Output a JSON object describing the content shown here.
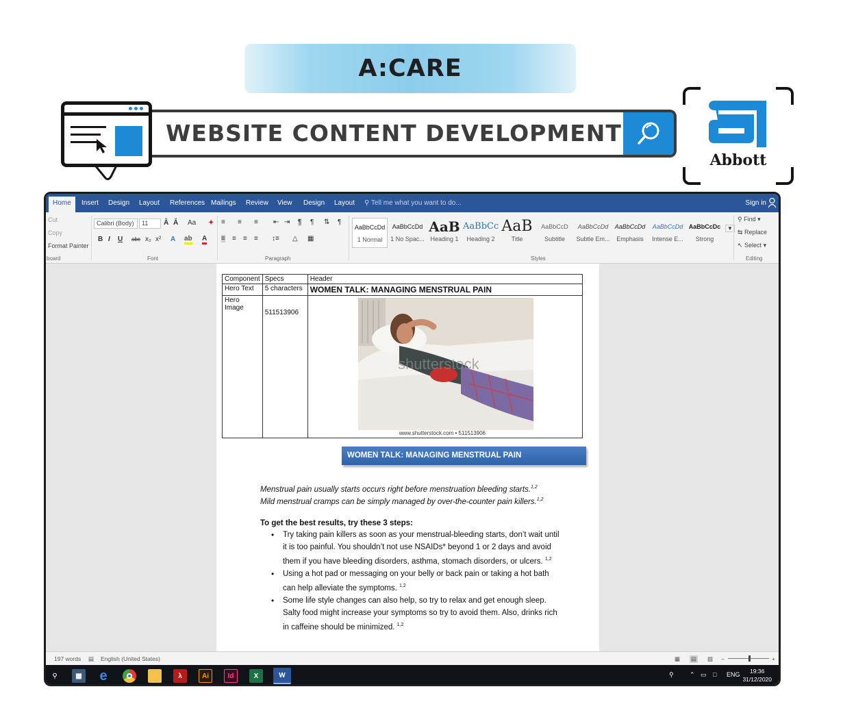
{
  "banner": {
    "title": "A:CARE",
    "search_label": "WEBSITE CONTENT DEVELOPMENT",
    "brand": "Abbott"
  },
  "colors": {
    "accent_blue": "#1c8ad6",
    "word_blue": "#2b579a",
    "heading_blue": "#2d62ab",
    "pill_blue": "#8ccdec"
  },
  "icons": [
    "browser-window-icon",
    "cursor-arrow-icon",
    "search-icon",
    "abbott-logo-icon",
    "person-icon"
  ],
  "word": {
    "tabs": [
      "Home",
      "Insert",
      "Design",
      "Layout",
      "References",
      "Mailings",
      "Review",
      "View",
      "Design",
      "Layout"
    ],
    "active_tab": "Home",
    "tell_me": "Tell me what you want to do...",
    "sign_in": "Sign in",
    "clipboard": {
      "cut": "Cut",
      "copy": "Copy",
      "format_painter": "Format Painter",
      "label": "board"
    },
    "font": {
      "family": "Calibri (Body)",
      "size": "11",
      "label": "Font"
    },
    "paragraph_label": "Paragraph",
    "styles": [
      {
        "preview": "AaBbCcDd",
        "name": "1 Normal"
      },
      {
        "preview": "AaBbCcDd",
        "name": "1 No Spac..."
      },
      {
        "preview": "AaB",
        "name": "Heading 1"
      },
      {
        "preview": "AaBbCc",
        "name": "Heading 2"
      },
      {
        "preview": "AaB",
        "name": "Title"
      },
      {
        "preview": "AaBbCcD",
        "name": "Subtitle"
      },
      {
        "preview": "AaBbCcDd",
        "name": "Subtle Em..."
      },
      {
        "preview": "AaBbCcDd",
        "name": "Emphasis"
      },
      {
        "preview": "AaBbCcDd",
        "name": "Intense E..."
      },
      {
        "preview": "AaBbCcDc",
        "name": "Strong"
      }
    ],
    "styles_label": "Styles",
    "editing": {
      "find": "Find",
      "replace": "Replace",
      "select": "Select",
      "label": "Editing"
    },
    "status": {
      "words": "197 words",
      "language": "English (United States)"
    },
    "tray": {
      "lang": "ENG",
      "time": "19:36",
      "date": "31/12/2020"
    }
  },
  "doc": {
    "table": {
      "headers": [
        "Component",
        "Specs",
        "Header"
      ],
      "row1": [
        "Hero Text",
        "5 characters",
        "WOMEN TALK: MANAGING MENSTRUAL PAIN"
      ],
      "row2": [
        "Hero Image",
        "511513906"
      ],
      "watermark": "shutterstock",
      "caption": "www.shutterstock.com • 511513906"
    },
    "heading": "WOMEN TALK: MANAGING MENSTRUAL PAIN",
    "intro1": "Menstrual pain usually starts occurs right before menstruation bleeding starts.",
    "intro2": "Mild menstrual cramps can be simply managed by over-the-counter pain killers.",
    "ref": "1,2",
    "steps_title": "To get the best results, try these 3 steps:",
    "bullets": [
      "Try taking pain killers as soon as your menstrual-bleeding starts, don’t wait until it is too painful. You shouldn’t not use NSAIDs* beyond 1 or 2 days and avoid them if you have bleeding disorders, asthma, stomach disorders, or ulcers.",
      "Using a hot pad or messaging on your belly or back pain or taking a hot bath can help alleviate the symptoms.",
      "Some life style changes can also help, so try to relax and get enough sleep. Salty food might increase your symptoms so try to avoid them. Also, drinks rich in caffeine should be minimized."
    ]
  }
}
